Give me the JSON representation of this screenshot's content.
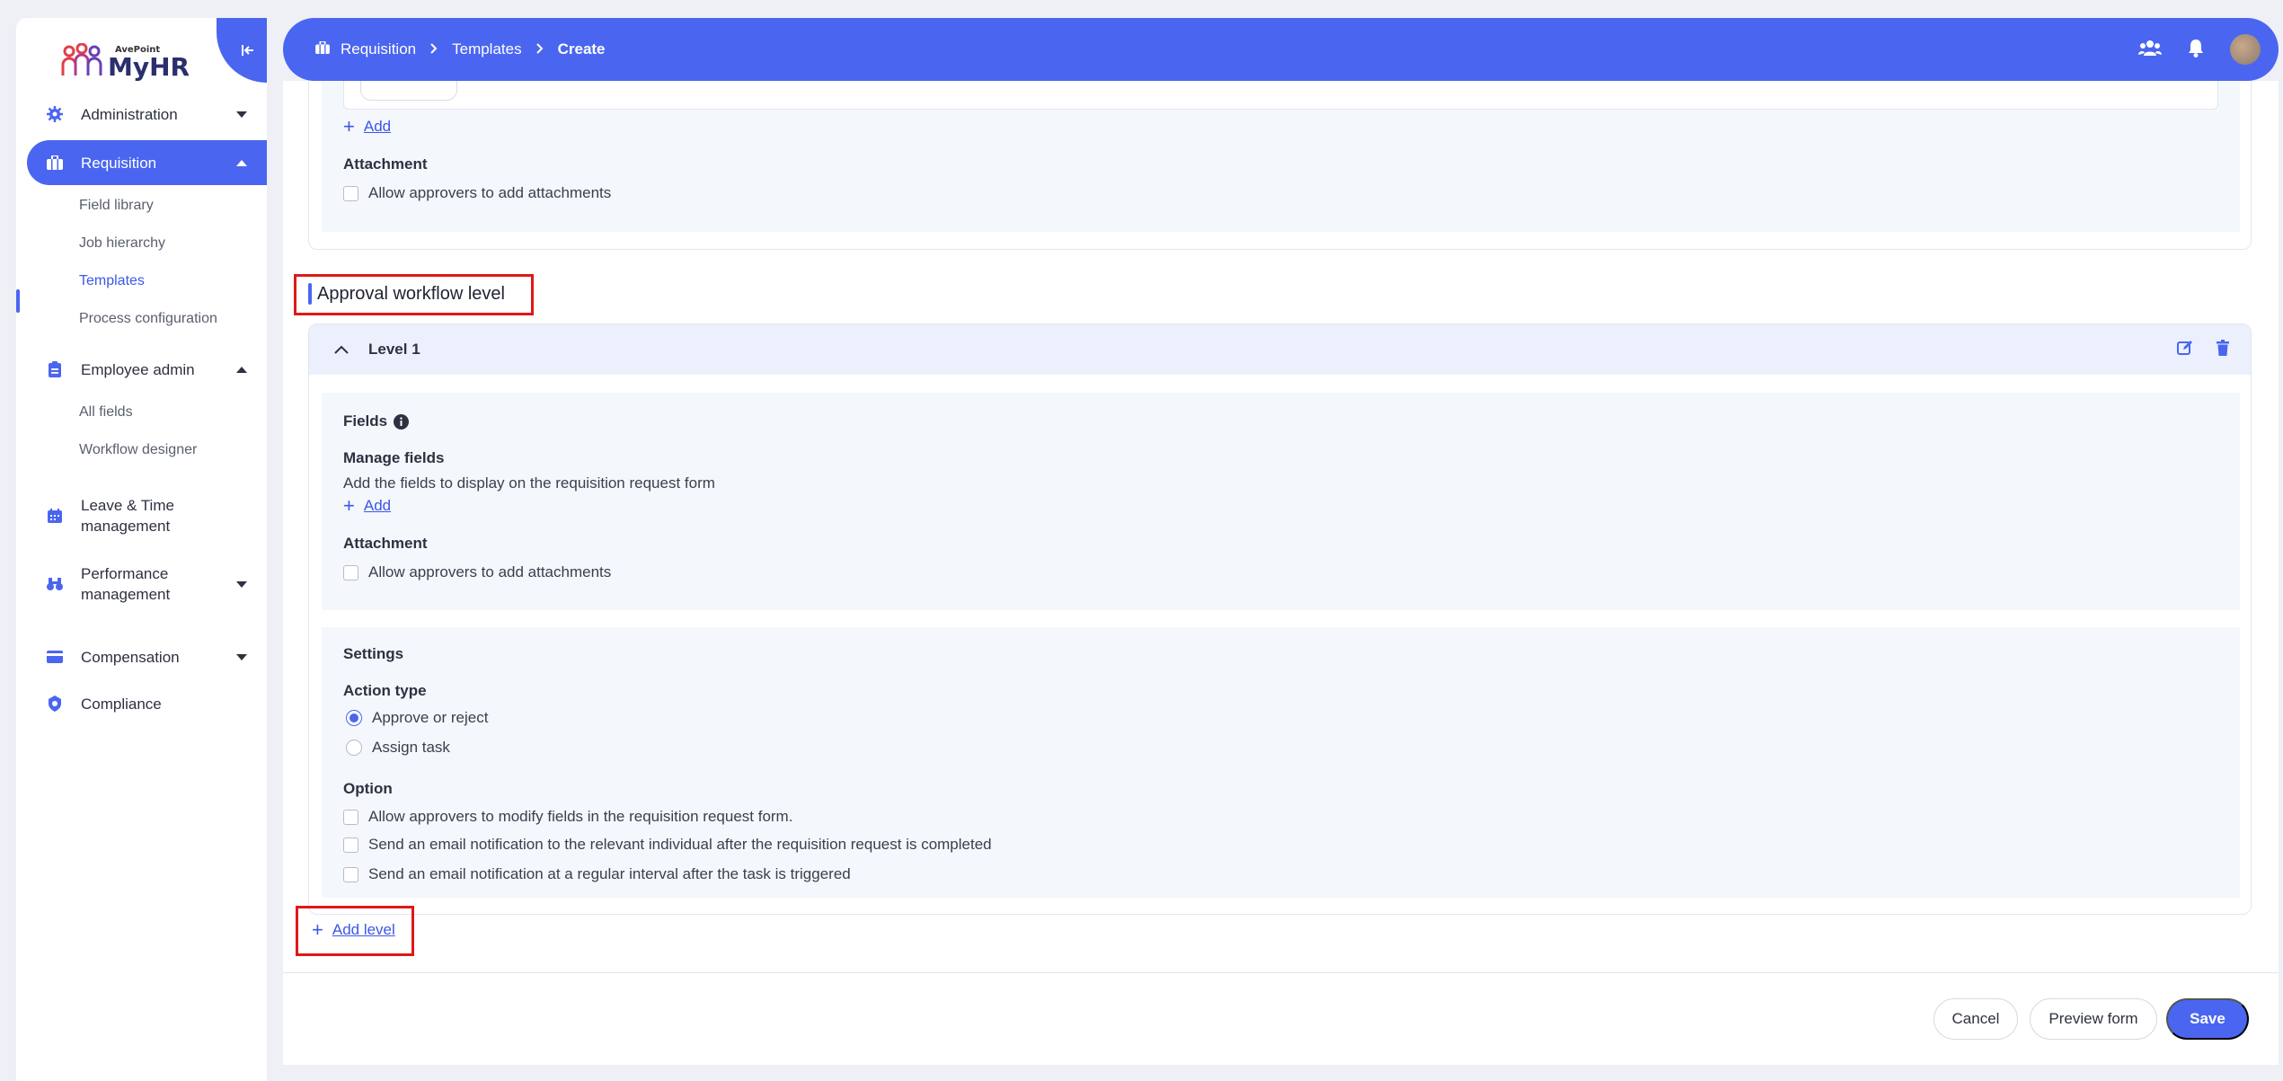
{
  "brand": {
    "name": "MyHR",
    "sub": "AvePoint"
  },
  "sidebar": {
    "items": [
      {
        "label": "Administration",
        "icon": "gear-icon"
      },
      {
        "label": "Requisition",
        "icon": "briefcase-icon"
      },
      {
        "label": "Employee admin",
        "icon": "clipboard-icon"
      },
      {
        "label": "Leave & Time management",
        "icon": "calendar-icon"
      },
      {
        "label": "Performance management",
        "icon": "binoculars-icon"
      },
      {
        "label": "Compensation",
        "icon": "card-icon"
      },
      {
        "label": "Compliance",
        "icon": "shield-gear-icon"
      }
    ],
    "requisition_sub": [
      "Field library",
      "Job hierarchy",
      "Templates",
      "Process configuration"
    ],
    "employee_sub": [
      "All fields",
      "Workflow designer"
    ]
  },
  "breadcrumb": {
    "items": [
      "Requisition",
      "Templates",
      "Create"
    ]
  },
  "top_section": {
    "add_label": "Add",
    "attachment_label": "Attachment",
    "attachment_option": "Allow approvers to add attachments"
  },
  "approval": {
    "title": "Approval workflow level",
    "level_title": "Level 1",
    "fields_label": "Fields",
    "manage_fields_label": "Manage fields",
    "manage_fields_desc": "Add the fields to display on the requisition request form",
    "add_label": "Add",
    "attachment_label": "Attachment",
    "attachment_option": "Allow approvers to add attachments",
    "settings_label": "Settings",
    "action_type_label": "Action type",
    "action_types": [
      {
        "label": "Approve or reject",
        "selected": true
      },
      {
        "label": "Assign task",
        "selected": false
      }
    ],
    "option_label": "Option",
    "options": [
      "Allow approvers to modify fields in the requisition request form.",
      "Send an email notification to the relevant individual after the requisition request is completed",
      "Send an email notification at a regular interval after the task is triggered"
    ],
    "add_level_label": "Add level"
  },
  "footer": {
    "cancel": "Cancel",
    "preview": "Preview form",
    "save": "Save"
  },
  "colors": {
    "accent": "#4a66f0",
    "highlight": "#e01818"
  }
}
